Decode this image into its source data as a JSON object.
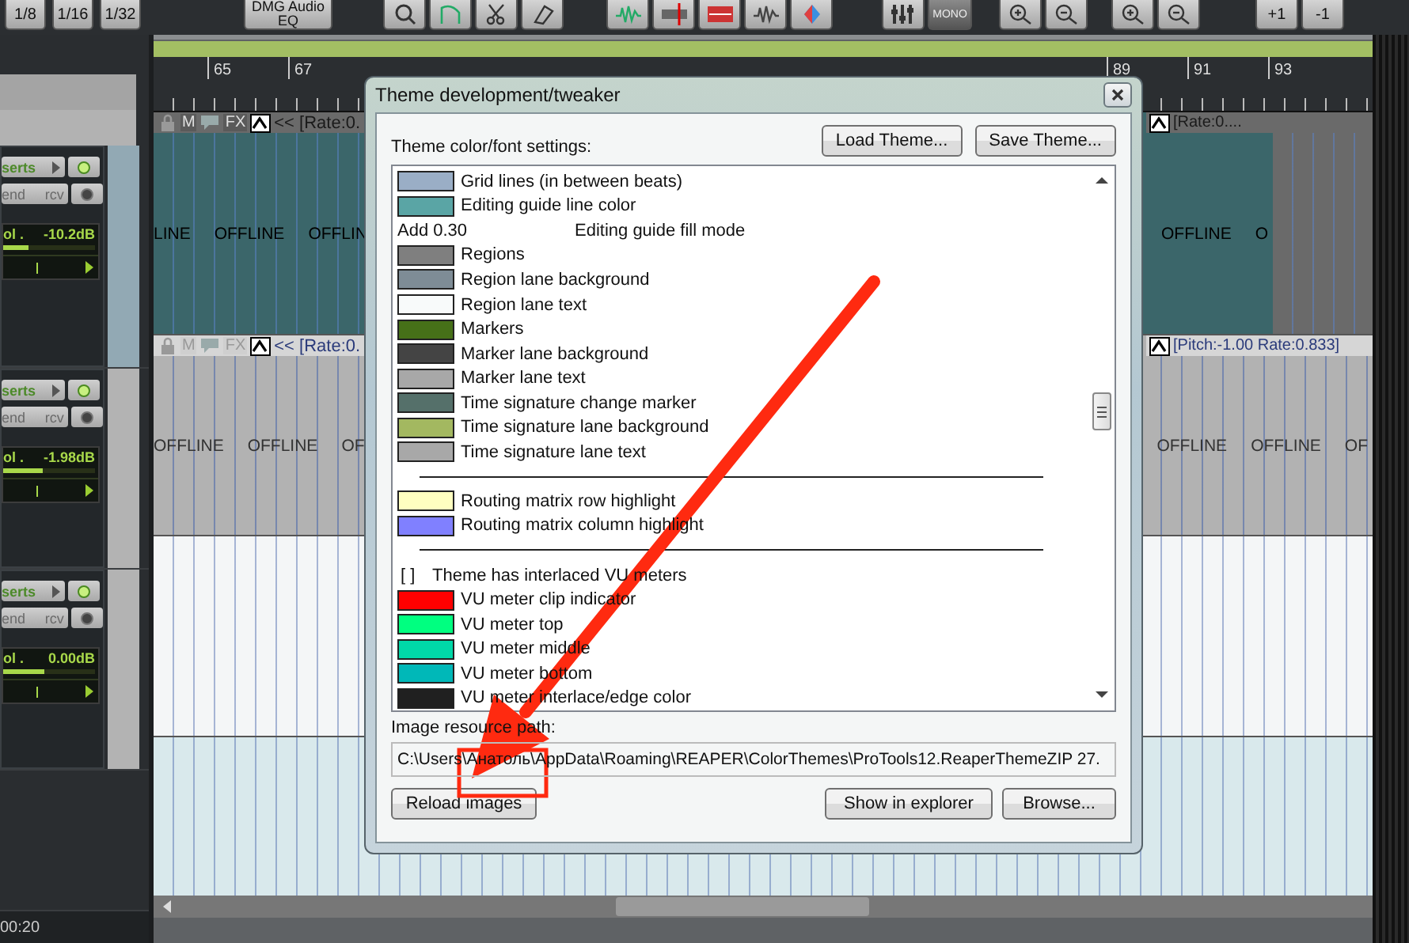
{
  "toolbar": {
    "snap_buttons": [
      "1/8",
      "1/16",
      "1/32"
    ],
    "plugin_button": "DMG Audio EQ",
    "mono_label": "MONO",
    "nudge_buttons": [
      "+1",
      "-1"
    ]
  },
  "ruler": {
    "left_labels": [
      "65",
      "67"
    ],
    "right_labels": [
      "89",
      "91",
      "93"
    ]
  },
  "tracks": [
    {
      "selected": true,
      "inserts": "serts",
      "sends": "end",
      "receives": "rcv",
      "volume_label": "ol .",
      "volume": "-10.2dB",
      "level": 0.28,
      "pan": {
        "level": 0.4
      },
      "item_buttons": [
        {
          "kind": "lock"
        },
        {
          "kind": "text",
          "label": "M"
        },
        {
          "kind": "note"
        },
        {
          "kind": "text",
          "label": "FX"
        },
        {
          "kind": "envelope"
        }
      ],
      "left_header": "<< [Rate:0.",
      "right_header": "[Rate:0....",
      "left_items": [
        "LINE",
        "OFFLINE",
        "OFFLIN"
      ],
      "right_items": [
        "OFFLINE",
        "O"
      ]
    },
    {
      "selected": false,
      "inserts": "serts",
      "sends": "end",
      "receives": "rcv",
      "volume_label": "ol .",
      "volume": "-1.98dB",
      "level": 0.43,
      "pan": {
        "level": 0.4
      },
      "item_buttons": [
        {
          "kind": "lock"
        },
        {
          "kind": "text",
          "label": "M"
        },
        {
          "kind": "note"
        },
        {
          "kind": "text",
          "label": "FX"
        },
        {
          "kind": "envelope"
        }
      ],
      "left_header": "<< [Rate:0.",
      "right_header": "[Pitch:-1.00 Rate:0.833]",
      "left_items": [
        "OFFLINE",
        "OFFLINE",
        "OF"
      ],
      "right_items": [
        "OFFLINE",
        "OFFLINE",
        "OF"
      ]
    },
    {
      "selected": false,
      "inserts": "serts",
      "sends": "end",
      "receives": "rcv",
      "volume_label": "ol .",
      "volume": "0.00dB",
      "level": 0.45,
      "pan": {
        "level": 0.4
      }
    }
  ],
  "time": "00:20",
  "dialog": {
    "title": "Theme development/tweaker",
    "settings_label": "Theme color/font settings:",
    "buttons": [
      "Load Theme...",
      "Save Theme..."
    ],
    "items": [
      {
        "kind": "color",
        "label": "Grid lines (in between beats)",
        "color": "#9aaec6"
      },
      {
        "kind": "color",
        "label": "Editing guide line color",
        "color": "#5aa5a5"
      },
      {
        "kind": "mode",
        "mode": "Add 0.30",
        "label": "Editing guide fill mode"
      },
      {
        "kind": "color",
        "label": "Regions",
        "color": "#7f7f7f"
      },
      {
        "kind": "color",
        "label": "Region lane background",
        "color": "#7e8c96"
      },
      {
        "kind": "color",
        "label": "Region lane text",
        "color": "#f8fafa"
      },
      {
        "kind": "color",
        "label": "Markers",
        "color": "#467018"
      },
      {
        "kind": "color",
        "label": "Marker lane background",
        "color": "#444444"
      },
      {
        "kind": "color",
        "label": "Marker lane text",
        "color": "#a8a8a8"
      },
      {
        "kind": "color",
        "label": "Time signature change marker",
        "color": "#55706a"
      },
      {
        "kind": "color",
        "label": "Time signature lane background",
        "color": "#a3b860"
      },
      {
        "kind": "color",
        "label": "Time signature lane text",
        "color": "#a8a8a8"
      },
      {
        "kind": "separator"
      },
      {
        "kind": "color",
        "label": "Routing matrix row highlight",
        "color": "#ffffc0"
      },
      {
        "kind": "color",
        "label": "Routing matrix column highlight",
        "color": "#8080ff"
      },
      {
        "kind": "separator"
      },
      {
        "kind": "checkbox",
        "mark": "[ ]",
        "label": "Theme has interlaced VU meters",
        "checked": false
      },
      {
        "kind": "color",
        "label": "VU meter clip indicator",
        "color": "#ff0000"
      },
      {
        "kind": "color",
        "label": "VU meter top",
        "color": "#00ff80"
      },
      {
        "kind": "color",
        "label": "VU meter middle",
        "color": "#00d8a8"
      },
      {
        "kind": "color",
        "label": "VU meter bottom",
        "color": "#00b8b8"
      },
      {
        "kind": "color",
        "label": "VU meter interlace/edge color",
        "color": "#202020"
      }
    ],
    "path_label": "Image resource path:",
    "path": "C:\\Users\\Анатоль\\AppData\\Roaming\\REAPER\\ColorThemes\\ProTools12.ReaperThemeZIP 27.",
    "bottom_buttons": [
      "Reload images",
      "Show in explorer",
      "Browse..."
    ]
  }
}
